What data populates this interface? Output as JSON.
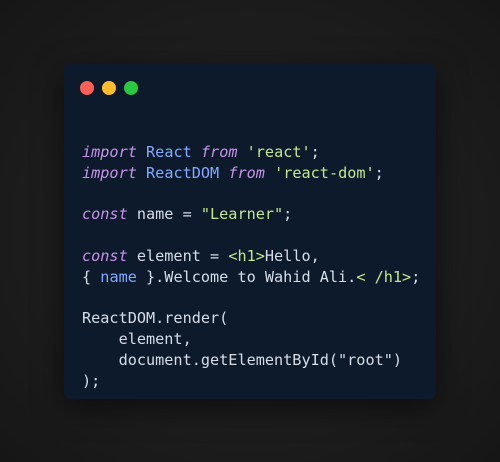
{
  "colors": {
    "background": "#1d1d1d",
    "window": "#0c1a2c",
    "close": "#ff5f56",
    "minimize": "#ffbd2e",
    "maximize": "#27c93f",
    "keyword": "#c792ea",
    "identifier": "#82aaff",
    "string": "#c3e88d",
    "text": "#d7dde8",
    "tag": "#ffcb6b"
  },
  "window_controls": {
    "close_icon": "close-dot-icon",
    "minimize_icon": "minimize-dot-icon",
    "maximize_icon": "maximize-dot-icon"
  },
  "code_lines": [
    [
      {
        "t": "import",
        "c": "keyword",
        "i": true
      },
      {
        "t": " "
      },
      {
        "t": "React",
        "c": "identifier"
      },
      {
        "t": " "
      },
      {
        "t": "from",
        "c": "keyword",
        "i": true
      },
      {
        "t": " "
      },
      {
        "t": "'react'",
        "c": "string"
      },
      {
        "t": ";"
      }
    ],
    [
      {
        "t": "import",
        "c": "keyword",
        "i": true
      },
      {
        "t": " "
      },
      {
        "t": "ReactDOM",
        "c": "identifier"
      },
      {
        "t": " "
      },
      {
        "t": "from",
        "c": "keyword",
        "i": true
      },
      {
        "t": " "
      },
      {
        "t": "'react-dom'",
        "c": "string"
      },
      {
        "t": ";"
      }
    ],
    [],
    [
      {
        "t": "const",
        "c": "keyword",
        "i": true
      },
      {
        "t": " name = "
      },
      {
        "t": "\"Learner\"",
        "c": "string"
      },
      {
        "t": ";"
      }
    ],
    [],
    [
      {
        "t": "const",
        "c": "keyword",
        "i": true
      },
      {
        "t": " element = "
      },
      {
        "t": "<h1>",
        "c": "string"
      },
      {
        "t": "Hello,"
      }
    ],
    [
      {
        "t": "{ "
      },
      {
        "t": "name",
        "c": "identifier"
      },
      {
        "t": " }.Welcome to Wahid Ali."
      },
      {
        "t": "< /h1>",
        "c": "string"
      },
      {
        "t": ";"
      }
    ],
    [],
    [
      {
        "t": "ReactDOM.render("
      }
    ],
    [
      {
        "t": "    element,"
      }
    ],
    [
      {
        "t": "    document.getElementById(\"root\")"
      }
    ],
    [
      {
        "t": ");"
      }
    ]
  ]
}
